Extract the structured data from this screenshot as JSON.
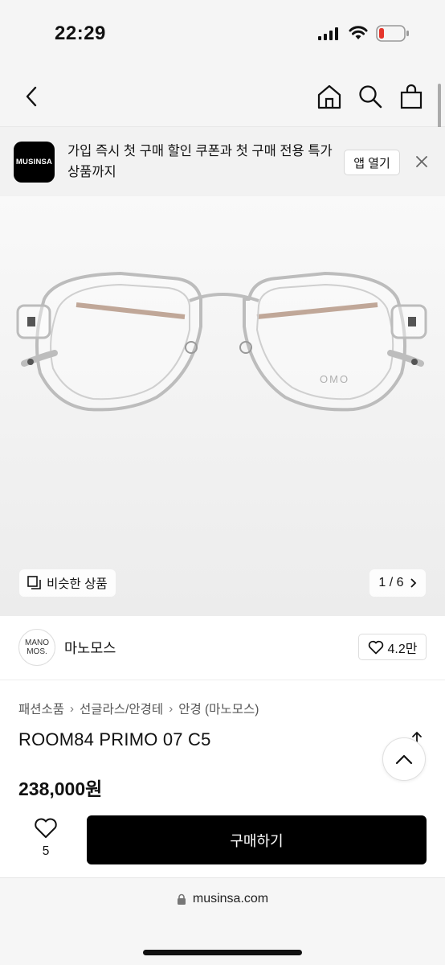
{
  "status_bar": {
    "time": "22:29"
  },
  "banner": {
    "logo_text": "MUSINSA",
    "message": "가입 즉시 첫 구매 할인 쿠폰과 첫 구매 전용 특가 상품까지",
    "open_app_label": "앱 열기"
  },
  "hero": {
    "frame_brand_mark": "OMO",
    "similar_label": "비슷한 상품",
    "pager": "1 / 6"
  },
  "brand": {
    "logo_line1": "MANO",
    "logo_line2": "MOS.",
    "name": "마노모스",
    "like_count": "4.2만"
  },
  "breadcrumb": [
    "패션소품",
    "선글라스/안경테",
    "안경 (마노모스)"
  ],
  "product": {
    "name": "ROOM84 PRIMO 07 C5",
    "price": "238,000원"
  },
  "buy_bar": {
    "like_count": "5",
    "buy_label": "구매하기"
  },
  "browser": {
    "url": "musinsa.com"
  },
  "colors": {
    "accent": "#000000",
    "battery_low": "#e5352b"
  },
  "icons": [
    "back-icon",
    "home-icon",
    "search-icon",
    "bag-icon",
    "close-icon",
    "similar-icon",
    "chevron-right-icon",
    "heart-icon",
    "share-icon",
    "chevron-up-icon",
    "lock-icon"
  ]
}
